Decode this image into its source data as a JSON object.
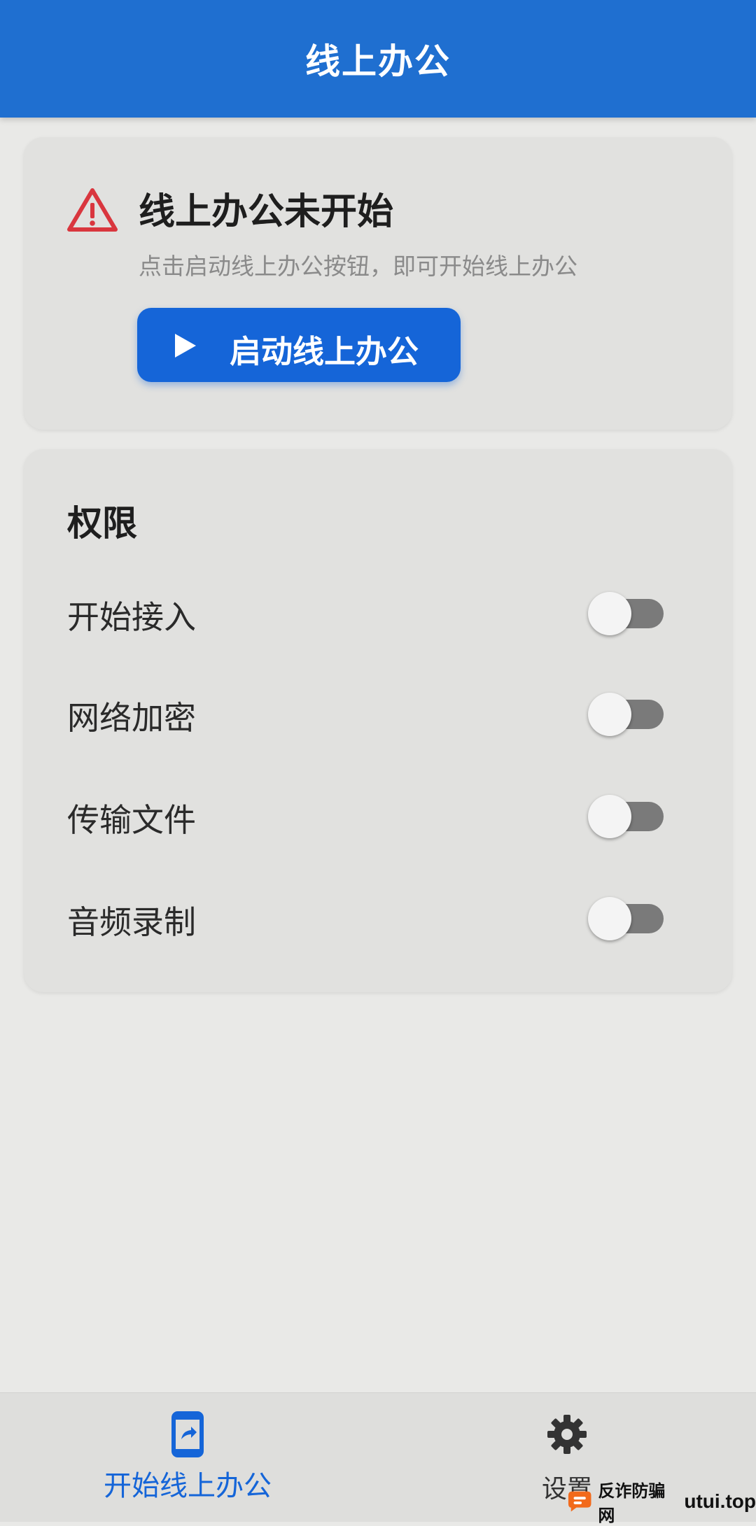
{
  "app_bar": {
    "title": "线上办公"
  },
  "status_card": {
    "title": "线上办公未开始",
    "description": "点击启动线上办公按钮，即可开始线上办公",
    "icon": "warning-triangle-icon",
    "start_button_label": "启动线上办公"
  },
  "permissions": {
    "title": "权限",
    "items": [
      {
        "label": "开始接入",
        "enabled": false
      },
      {
        "label": "网络加密",
        "enabled": false
      },
      {
        "label": "传输文件",
        "enabled": false
      },
      {
        "label": "音频录制",
        "enabled": false
      }
    ]
  },
  "bottom_nav": {
    "items": [
      {
        "label": "开始线上办公",
        "icon": "phone-share-icon",
        "active": true
      },
      {
        "label": "设置",
        "icon": "gear-icon",
        "active": false
      }
    ]
  },
  "watermark": {
    "cn": "反诈防骗网",
    "en": "utui.top"
  },
  "colors": {
    "primary": "#1f6fd0",
    "button": "#1565d8",
    "warning": "#d9363e",
    "background": "#e9e9e7",
    "card": "#e1e1df"
  }
}
